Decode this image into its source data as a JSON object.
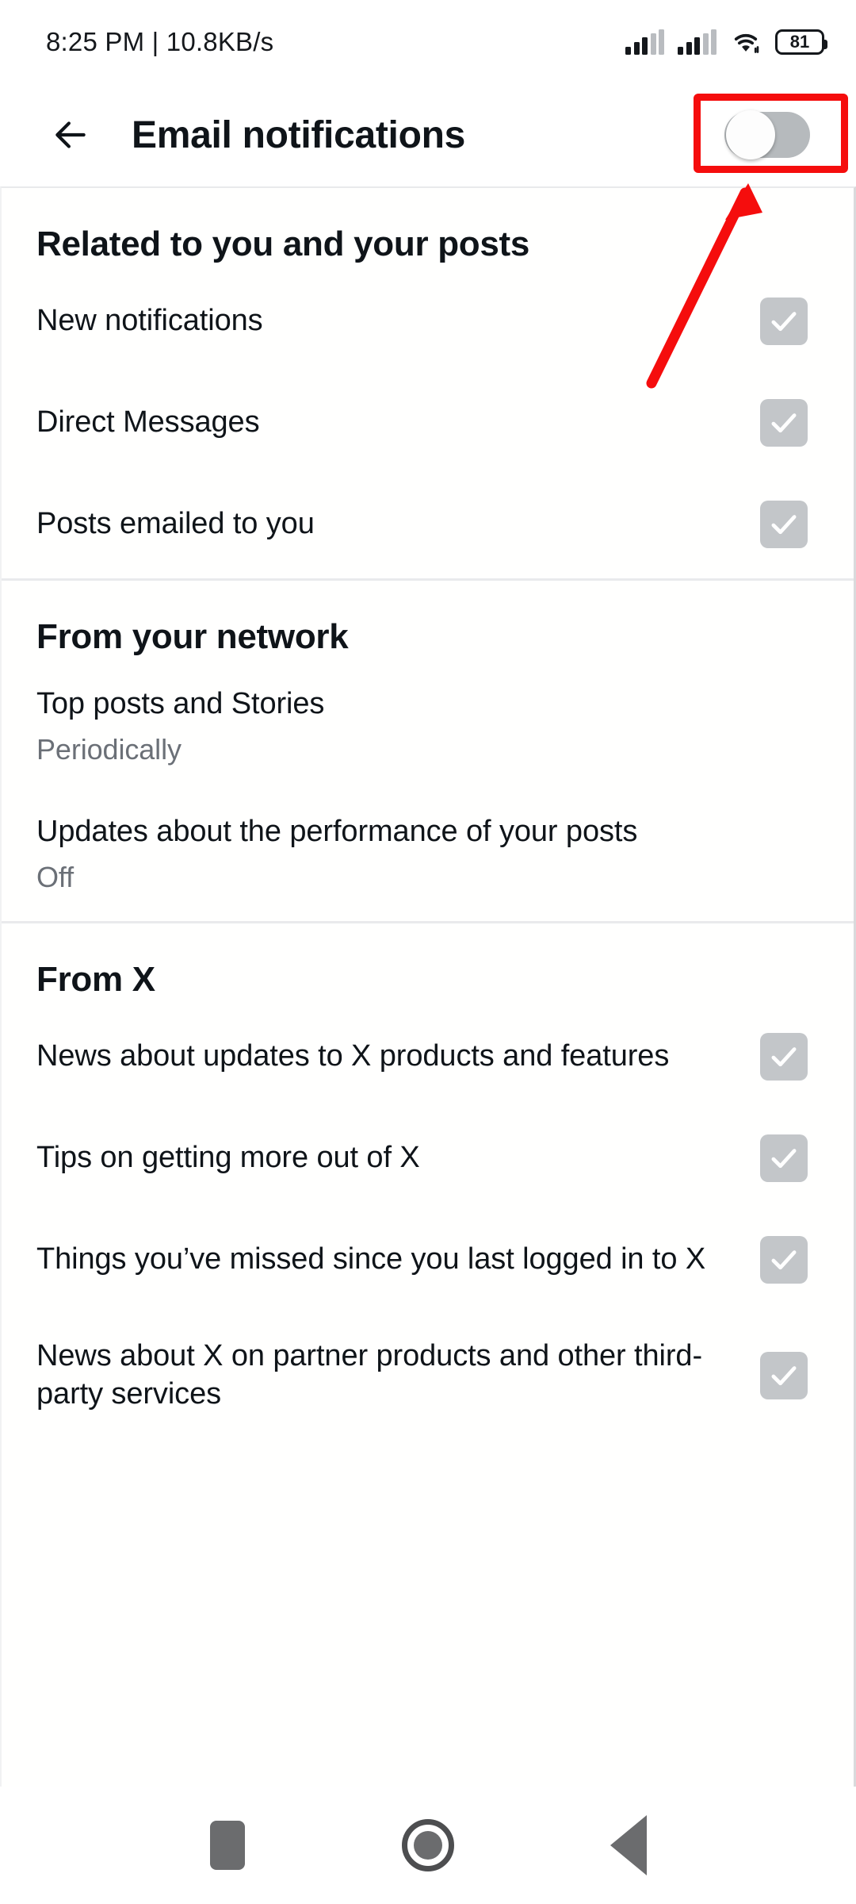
{
  "status_bar": {
    "time": "8:25 PM",
    "separator": "|",
    "network_speed": "10.8KB/s",
    "time_and_speed": "8:25 PM | 10.8KB/s",
    "battery_level": "81",
    "icons": [
      "signal-icon",
      "signal-icon",
      "wifi-icon",
      "battery-icon"
    ]
  },
  "appbar": {
    "back_label": "",
    "title": "Email notifications",
    "master_toggle": {
      "name": "email-notifications-master-toggle",
      "state": "off",
      "highlighted": true
    }
  },
  "sections": [
    {
      "title": "Related to you and your posts",
      "rows": [
        {
          "label": "New notifications",
          "sub": "",
          "control": "checkbox",
          "checked": true
        },
        {
          "label": "Direct Messages",
          "sub": "",
          "control": "checkbox",
          "checked": true
        },
        {
          "label": "Posts emailed to you",
          "sub": "",
          "control": "checkbox",
          "checked": true
        }
      ]
    },
    {
      "title": "From your network",
      "rows": [
        {
          "label": "Top posts and Stories",
          "sub": "Periodically",
          "control": "none",
          "checked": false
        },
        {
          "label": "Updates about the performance of your posts",
          "sub": "Off",
          "control": "none",
          "checked": false
        }
      ]
    },
    {
      "title": "From X",
      "rows": [
        {
          "label": "News about updates to X products and features",
          "sub": "",
          "control": "checkbox",
          "checked": true
        },
        {
          "label": "Tips on getting more out of X",
          "sub": "",
          "control": "checkbox",
          "checked": true
        },
        {
          "label": "Things you’ve missed since you last logged in to X",
          "sub": "",
          "control": "checkbox",
          "checked": true
        },
        {
          "label": "News about X on partner products and other third-party services",
          "sub": "",
          "control": "checkbox",
          "checked": true
        }
      ]
    }
  ],
  "annotation": {
    "highlight_color": "#f50d0d",
    "target": "email-notifications-master-toggle"
  },
  "navbar": {
    "recents_label": "",
    "home_label": "",
    "back_label": ""
  },
  "colors": {
    "text_primary": "#0f1419",
    "text_secondary": "#6b7077",
    "checkbox_bg": "#c3c6c9",
    "toggle_off_track": "#b6babd",
    "divider": "#e9eaec",
    "annotation_red": "#f50d0d"
  }
}
